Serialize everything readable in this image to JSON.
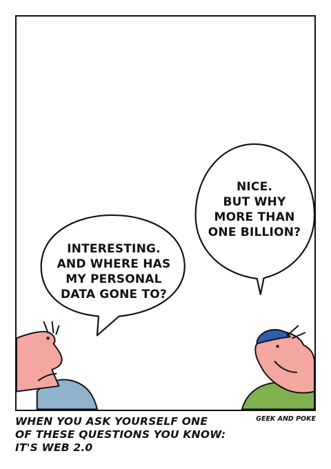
{
  "comic": {
    "left_bubble": {
      "lines": [
        "INTERESTING.",
        "AND WHERE HAS",
        "MY PERSONAL",
        "DATA GONE TO?"
      ]
    },
    "right_bubble": {
      "lines": [
        "NICE.",
        "BUT WHY",
        "MORE THAN",
        "ONE BILLION?"
      ]
    },
    "caption": {
      "lines": [
        "WHEN YOU ASK YOURSELF ONE",
        "OF THESE QUESTIONS YOU KNOW:",
        "IT'S WEB 2.0"
      ]
    },
    "credit": "GEEK AND POKE"
  },
  "colors": {
    "skin": "#f4a6a0",
    "left_shirt": "#8fb3cf",
    "right_shirt": "#7fb24e",
    "cap": "#2f5fb0",
    "ink": "#111111"
  }
}
